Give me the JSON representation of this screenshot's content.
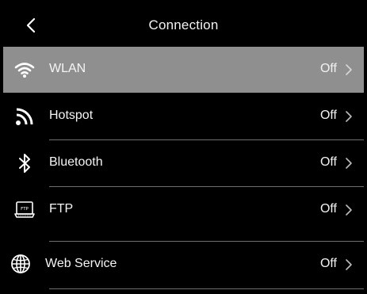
{
  "header": {
    "title": "Connection",
    "back_icon": "chevron-left-icon"
  },
  "items": [
    {
      "label": "WLAN",
      "value": "Off",
      "icon": "wifi-icon",
      "selected": true
    },
    {
      "label": "Hotspot",
      "value": "Off",
      "icon": "hotspot-icon",
      "selected": false
    },
    {
      "label": "Bluetooth",
      "value": "Off",
      "icon": "bluetooth-icon",
      "selected": false
    },
    {
      "label": "FTP",
      "value": "Off",
      "icon": "ftp-icon",
      "selected": false
    },
    {
      "label": "Web Service",
      "value": "Off",
      "icon": "globe-icon",
      "selected": false
    }
  ],
  "colors": {
    "background": "#000000",
    "selected_row": "#8f8f8f",
    "text": "#ffffff",
    "divider": "#6f6f6f"
  }
}
